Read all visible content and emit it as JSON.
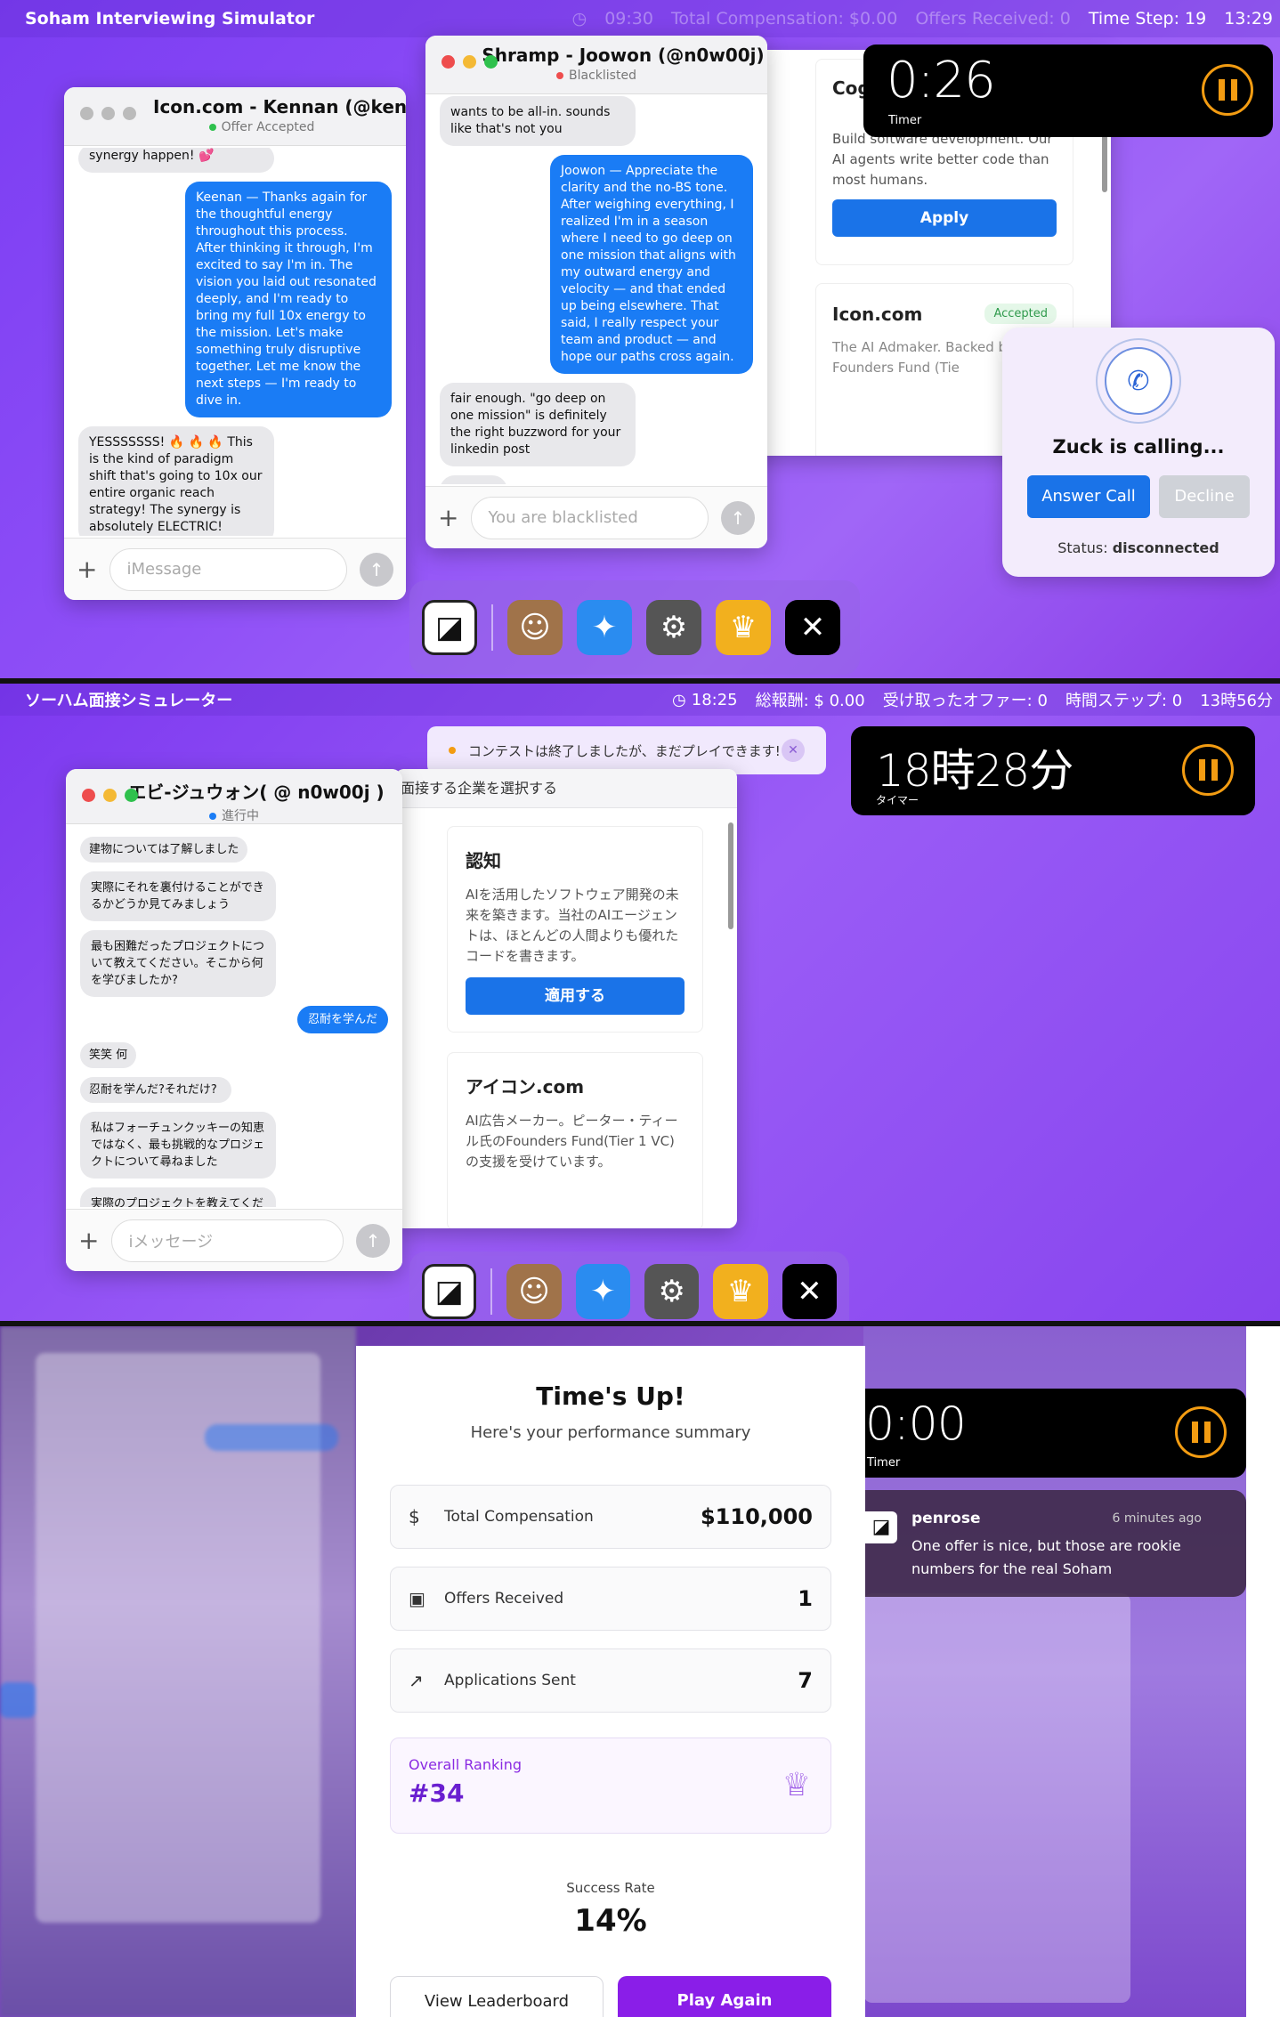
{
  "p1": {
    "menubar": {
      "apple": "",
      "app": "Soham Interviewing Simulator",
      "clock": "09:30",
      "comp": "Total Compensation: $0.00",
      "offers": "Offers Received: 0",
      "step": "Time Step: 19",
      "time": "13:29"
    },
    "kennan": {
      "title": "Icon.com - Kennan (@kennanday",
      "status": "Offer Accepted",
      "status_color": "#2fc14d",
      "m0": "synergy happen! 💕",
      "m1": "Keenan — Thanks again for the thoughtful energy throughout this process. After thinking it through, I'm excited to say I'm in. The vision you laid out resonated deeply, and I'm ready to bring my full 10x energy to the mission. Let's make something truly disruptive together. Let me know the next steps — I'm ready to dive in.",
      "m2": "YESSSSSSS! 🔥 🔥 🔥 This is the kind of paradigm shift that's going to 10x our entire organic reach strategy! The synergy is absolutely ELECTRIC!",
      "placeholder": "iMessage"
    },
    "joowon": {
      "title": "Shramp - Joowon (@n0w00j)",
      "status": "Blacklisted",
      "status_color": "#ee4d4d",
      "m0": "wants to be all-in. sounds like that's not you",
      "m1": "Joowon — Appreciate the clarity and the no-BS tone. After weighing everything, I realized I'm in a season where I need to go deep on one mission that aligns with my outward energy and velocity — and that ended up being elsewhere. That said, I really respect your team and product — and hope our paths cross again.",
      "m2": "fair enough. \"go deep on one mission\" is definitely the right buzzword for your linkedin post",
      "placeholder": "You are blacklisted"
    },
    "cog": {
      "title": "Cog",
      "desc": "Build software development. Our AI agents write better code than most humans.",
      "apply": "Apply"
    },
    "icon": {
      "title": "Icon.com",
      "badge": "Accepted",
      "desc": "The AI Admaker. Backed b Thiel's Founders Fund (Tie"
    },
    "timer": {
      "value": "0:26",
      "label": "Timer"
    },
    "call": {
      "title": "Zuck is calling...",
      "answer": "Answer Call",
      "decline": "Decline",
      "status_label": "Status: ",
      "status": "disconnected"
    }
  },
  "p2": {
    "menubar": {
      "apple": "",
      "app": "ソーハム面接シミュレーター",
      "clock": "18:25",
      "comp": "総報酬: $ 0.00",
      "offers": "受け取ったオファー: 0",
      "step": "時間ステップ: 0",
      "time": "13時56分"
    },
    "banner": "コンテストは終了しましたが、まだプレイできます!",
    "chat": {
      "title": "エビ-ジュウォン( @ n0w00j )",
      "status": "進行中",
      "status_color": "#1a7cf5",
      "m0": "建物については了解しました",
      "m1": "実際にそれを裏付けることができるかどうか見てみましょう",
      "m2": "最も困難だったプロジェクトについて教えてください。そこから何を学びましたか?",
      "m3": "忍耐を学んだ",
      "m4": "笑笑 何",
      "m5": "忍耐を学んだ?それだけ?",
      "m6": "私はフォーチュンクッキーの知恵ではなく、最も挑戦的なプロジェクトについて尋ねました",
      "m7": "実際のプロジェクトを教えてください。何を構築したか、何がうまくいかなかったのか、どのように修正したのか",
      "placeholder": "iメッセージ"
    },
    "companies": {
      "header": "面接する企業を選択する",
      "c1": {
        "title": "認知",
        "desc": "AIを活用したソフトウェア開発の未来を築きます。当社のAIエージェントは、ほとんどの人間よりも優れたコードを書きます。",
        "apply": "適用する"
      },
      "c2": {
        "title": "アイコン.com",
        "desc": "AI広告メーカー。ピーター・ティール氏のFounders Fund(Tier 1 VC)の支援を受けています。"
      }
    },
    "timer": {
      "value": "18時28分",
      "label": "タイマー"
    }
  },
  "p3": {
    "summary": {
      "title": "Time's Up!",
      "subtitle": "Here's your performance summary",
      "comp_label": "Total Compensation",
      "comp": "$110,000",
      "offers_label": "Offers Received",
      "offers": "1",
      "apps_label": "Applications Sent",
      "apps": "7",
      "rank_label": "Overall Ranking",
      "rank": "#34",
      "rate_label": "Success Rate",
      "rate": "14%",
      "leaderboard": "View Leaderboard",
      "play": "Play Again"
    },
    "timer": {
      "value": "0:00",
      "label": "Timer"
    },
    "notif": {
      "from": "penrose",
      "ago": "6 minutes ago",
      "text": "One offer is nice, but those are rookie numbers for the real Soham"
    }
  }
}
